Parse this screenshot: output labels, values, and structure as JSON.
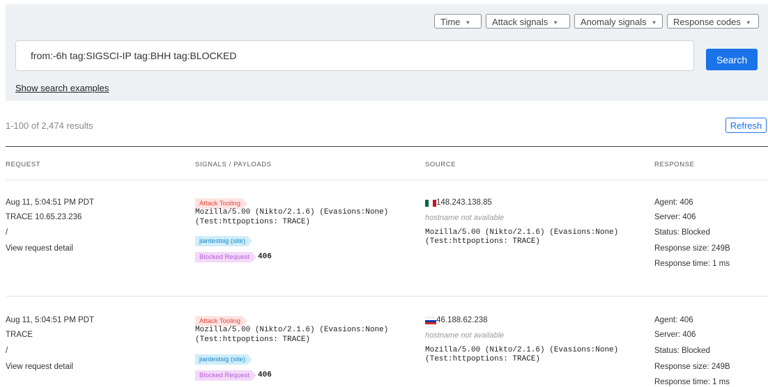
{
  "filters": [
    "Time",
    "Attack signals",
    "Anomaly signals",
    "Response codes"
  ],
  "search": {
    "query": "from:-6h tag:SIGSCI-IP tag:BHH tag:BLOCKED",
    "button_label": "Search",
    "examples_link": "Show search examples"
  },
  "results": {
    "summary": "1-100 of 2,474 results",
    "refresh_label": "Refresh"
  },
  "columns": {
    "request": "REQUEST",
    "signals": "SIGNALS / PAYLOADS",
    "source": "SOURCE",
    "response": "RESPONSE"
  },
  "rows": [
    {
      "timestamp": "Aug 11, 5:04:51 PM PDT",
      "request_line": "TRACE 10.65.23.236",
      "path": "/",
      "detail_link": "View request detail",
      "attack_tag": "Attack Tooling",
      "payload_line1": "Mozilla/5.00 (Nikto/2.1.6) (Evasions:None)",
      "payload_line2": "(Test:httpoptions: TRACE)",
      "site_tag": "jiantestsig (site)",
      "blocked_tag": "Blocked Request",
      "blocked_code": "406",
      "flag": "mexico-flag-icon",
      "source_ip": "148.243.138.85",
      "hostname": "hostname not available",
      "ua_line1": "Mozilla/5.00 (Nikto/2.1.6) (Evasions:None)",
      "ua_line2": "(Test:httpoptions: TRACE)",
      "agent": "Agent: 406",
      "server": "Server: 406",
      "status": "Status: Blocked",
      "size": "Response size: 249B",
      "time": "Response time: 1 ms"
    },
    {
      "timestamp": "Aug 11, 5:04:51 PM PDT",
      "request_line": "TRACE",
      "path": "/",
      "detail_link": "View request detail",
      "attack_tag": "Attack Tooling",
      "payload_line1": "Mozilla/5.00 (Nikto/2.1.6) (Evasions:None)",
      "payload_line2": "(Test:httpoptions: TRACE)",
      "site_tag": "jiantestsig (site)",
      "blocked_tag": "Blocked Request",
      "blocked_code": "406",
      "flag": "russia-flag-icon",
      "source_ip": "46.188.62.238",
      "hostname": "hostname not available",
      "ua_line1": "Mozilla/5.00 (Nikto/2.1.6) (Evasions:None)",
      "ua_line2": "(Test:httpoptions: TRACE)",
      "agent": "Agent: 406",
      "server": "Server: 406",
      "status": "Status: Blocked",
      "size": "Response size: 249B",
      "time": "Response time: 1 ms"
    }
  ],
  "colors": {
    "accent": "#1a73e8",
    "panel": "#eef1f4",
    "attack_tag_bg": "#fde3e1",
    "site_tag_bg": "#cfeefb",
    "blocked_tag_bg": "#f3d9fb"
  }
}
